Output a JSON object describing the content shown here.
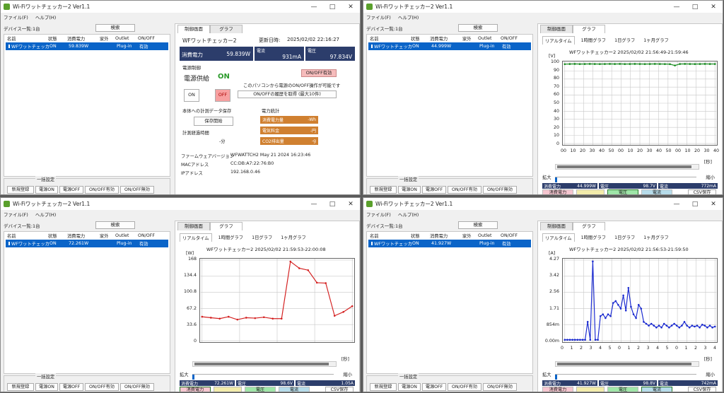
{
  "app_title": "Wi-Fiワットチェッカー2 Ver1.1",
  "menu": {
    "file": "ファイル(F)",
    "help": "ヘルプ(H)"
  },
  "device_count": "デバイス一覧:1台",
  "search_label": "検索",
  "columns": [
    "名前",
    "状態",
    "消費電力",
    "家外",
    "Outlet",
    "ON/OFF"
  ],
  "bulk": {
    "label": "一括設定",
    "buttons": [
      "新規登録",
      "電源ON",
      "電源OFF",
      "ON/OFF有効",
      "ON/OFF無効"
    ]
  },
  "tabs": [
    "制御画面",
    "グラフ"
  ],
  "subtabs": [
    "リアルタイム",
    "1時間グラフ",
    "1日グラフ",
    "1ヶ月グラフ"
  ],
  "units_sec": "[秒]",
  "zoom": {
    "in": "拡大",
    "out": "縮小"
  },
  "legend": {
    "power": "消費電力",
    "volt": "電圧",
    "current": "電流",
    "csv": "CSV保存"
  },
  "windows": [
    {
      "row": {
        "name": "WFワットチェッカー2",
        "state": "ON",
        "power": "59.839W",
        "outlet": "Plug-in",
        "onoff": "有効"
      },
      "status": {
        "device": "WFワットチェッカー2",
        "updated_label": "更新日時:",
        "updated": "2025/02/02 22:16:27",
        "power_label": "消費電力",
        "power": "59.839W",
        "current_label": "電流",
        "current": "931mA",
        "volt_label": "電圧",
        "volt": "97.834V",
        "control_label": "電源制御",
        "supply_label": "電源供給",
        "supply": "ON",
        "onoff_badge": "ON/OFF有効",
        "notice": "このパソコンから電源のON/OFF操作が可能です",
        "on_btn": "ON",
        "off_btn": "OFF",
        "history_btn": "ON/OFFの履歴を取得 (最大10件)",
        "save_label": "本体への計測データ保存",
        "save_btn": "保存開始",
        "elapsed_label": "計測経過時間",
        "elapsed": "-分",
        "stats_label": "電力統計",
        "stats": [
          {
            "name": "消費電力量",
            "value": "-Wh"
          },
          {
            "name": "電気料金",
            "value": "-円"
          },
          {
            "name": "CO2排出量",
            "value": "-g"
          }
        ],
        "fw_label": "ファームウェアバージョン",
        "fw": "WFWATTCH2 May 21 2024 16:23:46",
        "mac_label": "MACアドレス",
        "mac": "CC:DB:A7:22:76:B0",
        "ip_label": "IPアドレス",
        "ip": "192.168.0.46"
      }
    },
    {
      "row": {
        "name": "WFワットチェッカー2",
        "state": "ON",
        "power": "44.999W",
        "outlet": "Plug-in",
        "onoff": "有効"
      },
      "graph": {
        "title": "WFワットチェッカー2 2025/02/02 21:56:49-21:59:46",
        "unit": "[V]",
        "measures": {
          "power": "44.999W",
          "volt": "98.7V",
          "current": "772mA"
        },
        "active": "volt"
      },
      "chart_data": {
        "type": "line",
        "ylim": [
          0,
          100
        ],
        "yticks": [
          "0",
          "10",
          "20",
          "30",
          "40",
          "50",
          "60",
          "70",
          "80",
          "90",
          "100"
        ],
        "xticks": [
          "00",
          "10",
          "20",
          "30",
          "40",
          "50",
          "00",
          "10",
          "20",
          "30",
          "40",
          "50",
          "00",
          "10",
          "20",
          "30",
          "40"
        ],
        "color": "#138a1b",
        "values": [
          98.4,
          98.6,
          98.7,
          98.5,
          98.6,
          98.7,
          98.6,
          98.5,
          98.6,
          98.7,
          98.6,
          98.7,
          98.5,
          98.6,
          98.7,
          98.6,
          98.5,
          98.6,
          98.7,
          98.6,
          98.5,
          98.4,
          96.8,
          98.6,
          98.7,
          98.6,
          98.5,
          98.6,
          98.7,
          98.6,
          98.6
        ]
      }
    },
    {
      "row": {
        "name": "WFワットチェッカー2",
        "state": "ON",
        "power": "72.261W",
        "outlet": "Plug-in",
        "onoff": "有効"
      },
      "graph": {
        "title": "WFワットチェッカー2 2025/02/02 21:59:53-22:00:08",
        "unit": "[W]",
        "measures": {
          "power": "72.261W",
          "volt": "98.6V",
          "current": "1.05A"
        },
        "active": "power"
      },
      "chart_data": {
        "type": "line",
        "ylim": [
          0,
          168
        ],
        "yticks": [
          "0",
          "33.6",
          "67.2",
          "100.8",
          "134.4",
          "168"
        ],
        "xticks": [],
        "color": "#d42020",
        "values": [
          50,
          48,
          46,
          50,
          44,
          48,
          47,
          49,
          46,
          46,
          165,
          151,
          147,
          121,
          120,
          52,
          60,
          72
        ]
      }
    },
    {
      "row": {
        "name": "WFワットチェッカー2",
        "state": "ON",
        "power": "41.927W",
        "outlet": "Plug-in",
        "onoff": "有効"
      },
      "graph": {
        "title": "WFワットチェッカー2 2025/02/02 21:56:53-21:59:50",
        "unit": "[A]",
        "measures": {
          "power": "41.927W",
          "volt": "98.8V",
          "current": "742mA"
        },
        "active": "current"
      },
      "chart_data": {
        "type": "line",
        "ylim": [
          0,
          4.27
        ],
        "yticks": [
          "0.00m",
          "854m",
          "1.71",
          "2.56",
          "3.42",
          "4.27"
        ],
        "xticks": [
          "0",
          "1",
          "2",
          "3",
          "4",
          "5",
          "0",
          "1",
          "2",
          "3",
          "4",
          "5",
          "0",
          "1",
          "2",
          "3",
          "4"
        ],
        "color": "#1a2ad0",
        "values": [
          0.05,
          0.05,
          0.05,
          0.05,
          0.05,
          0.05,
          0.05,
          0.05,
          0.05,
          1.0,
          0.05,
          4.2,
          0.05,
          0.05,
          1.3,
          1.4,
          1.2,
          1.4,
          1.3,
          2.0,
          2.1,
          1.9,
          1.7,
          2.4,
          1.6,
          2.8,
          1.8,
          1.4,
          1.2,
          1.9,
          1.7,
          1.0,
          0.9,
          0.8,
          0.9,
          0.8,
          0.7,
          0.8,
          0.7,
          0.9,
          0.8,
          0.7,
          0.8,
          0.9,
          0.8,
          0.7,
          0.8,
          1.0,
          0.8,
          0.7,
          0.8,
          0.75,
          0.8,
          0.7,
          0.85,
          0.8,
          0.7,
          0.8,
          0.7,
          0.75
        ]
      }
    }
  ]
}
